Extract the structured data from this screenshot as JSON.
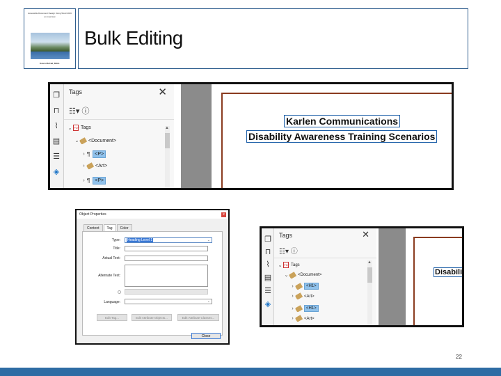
{
  "slide": {
    "title": "Bulk Editing",
    "number": "22",
    "thumbnail": {
      "line1": "Accessible Document Design Using Word 2016",
      "line2": "an overview",
      "author": "Karen McCall, M.Ed."
    }
  },
  "shot1": {
    "panel_title": "Tags",
    "close_glyph": "✕",
    "options_glyph": "☷▾ ⓘ",
    "tree": {
      "root": "Tags",
      "document": "<Document>",
      "items": [
        {
          "caret": "›",
          "icon": "¶",
          "label": "<P>",
          "highlighted": true
        },
        {
          "caret": "›",
          "icon": "tag",
          "label": "<Art>",
          "highlighted": false
        },
        {
          "caret": "›",
          "icon": "¶",
          "label": "<P>",
          "highlighted": true
        }
      ]
    },
    "page_lines": [
      "Karlen Communications",
      "Disability Awareness Training Scenarios"
    ]
  },
  "dialog": {
    "title": "Object Properties",
    "close": "x",
    "tabs": [
      "Content",
      "Tag",
      "Color"
    ],
    "active_tab": "Tag",
    "fields": {
      "type_label": "Type:",
      "type_value": "Heading Level 1",
      "title_label": "Title:",
      "actual_text_label": "Actual Text:",
      "alternate_text_label": "Alternate Text:",
      "language_label": "Language:"
    },
    "buttons": {
      "edit_tag": "Edit Tag...",
      "edit_attribute_objects": "Edit Attribute Objects...",
      "edit_attribute_classes": "Edit Attribute Classes...",
      "close": "Close"
    }
  },
  "shot3": {
    "panel_title": "Tags",
    "close_glyph": "✕",
    "options_glyph": "☷▾ ⓘ",
    "tree": {
      "root": "Tags",
      "document": "<Document>",
      "items": [
        {
          "caret": "›",
          "label": "<H1>",
          "highlighted": true
        },
        {
          "caret": "›",
          "label": "<Art>",
          "highlighted": false
        },
        {
          "caret": "›",
          "label": "<H1>",
          "highlighted": true
        },
        {
          "caret": "›",
          "label": "<Art>",
          "highlighted": false
        }
      ]
    },
    "page_text": "Disabili"
  }
}
